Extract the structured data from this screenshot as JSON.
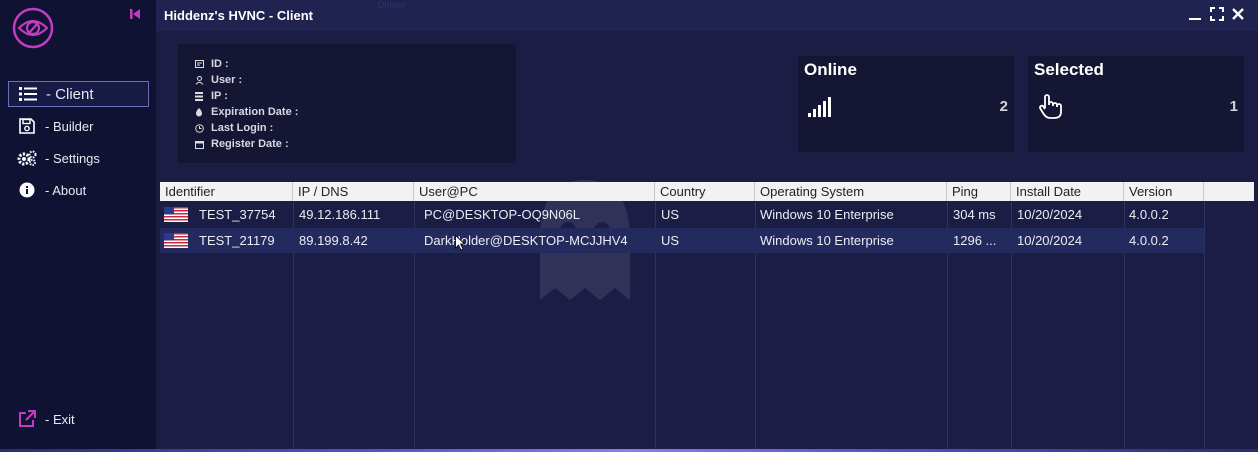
{
  "app": {
    "title": "Hiddenz's HVNC - Client",
    "faint_caption": "Dnjwer"
  },
  "sidebar": {
    "items": [
      {
        "label": "- Client",
        "icon": "list-icon",
        "active": true
      },
      {
        "label": "- Builder",
        "icon": "save-icon",
        "active": false
      },
      {
        "label": "- Settings",
        "icon": "gears-icon",
        "active": false
      },
      {
        "label": "- About",
        "icon": "info-icon",
        "active": false
      }
    ],
    "exit_label": "- Exit"
  },
  "info": {
    "id_label": "ID :",
    "user_label": "User :",
    "ip_label": "IP :",
    "expiration_label": "Expiration Date :",
    "last_login_label": "Last Login :",
    "register_label": "Register Date :"
  },
  "cards": {
    "online": {
      "title": "Online",
      "value": "2",
      "icon": "signal-bars-icon"
    },
    "selected": {
      "title": "Selected",
      "value": "1",
      "icon": "hand-pointer-icon"
    }
  },
  "table": {
    "columns": [
      "Identifier",
      "IP / DNS",
      "User@PC",
      "Country",
      "Operating System",
      "Ping",
      "Install Date",
      "Version"
    ],
    "rows": [
      {
        "identifier": "TEST_37754",
        "ip": "49.12.186.111",
        "user_pc": "PC@DESKTOP-OQ9N06L",
        "country": "US",
        "os": "Windows 10 Enterprise",
        "ping": "304 ms",
        "install_date": "10/20/2024",
        "version": "4.0.0.2",
        "selected": false
      },
      {
        "identifier": "TEST_21179",
        "ip": "89.199.8.42",
        "user_pc": "DarkHolder@DESKTOP-MCJJHV4",
        "country": "US",
        "os": "Windows 10 Enterprise",
        "ping": "1296 ...",
        "install_date": "10/20/2024",
        "version": "4.0.0.2",
        "selected": true
      }
    ]
  },
  "colors": {
    "accent": "#c13cc0",
    "sidebar_bg": "#0f1233",
    "main_bg": "#1b1d45",
    "selected_row": "#232b5e"
  }
}
